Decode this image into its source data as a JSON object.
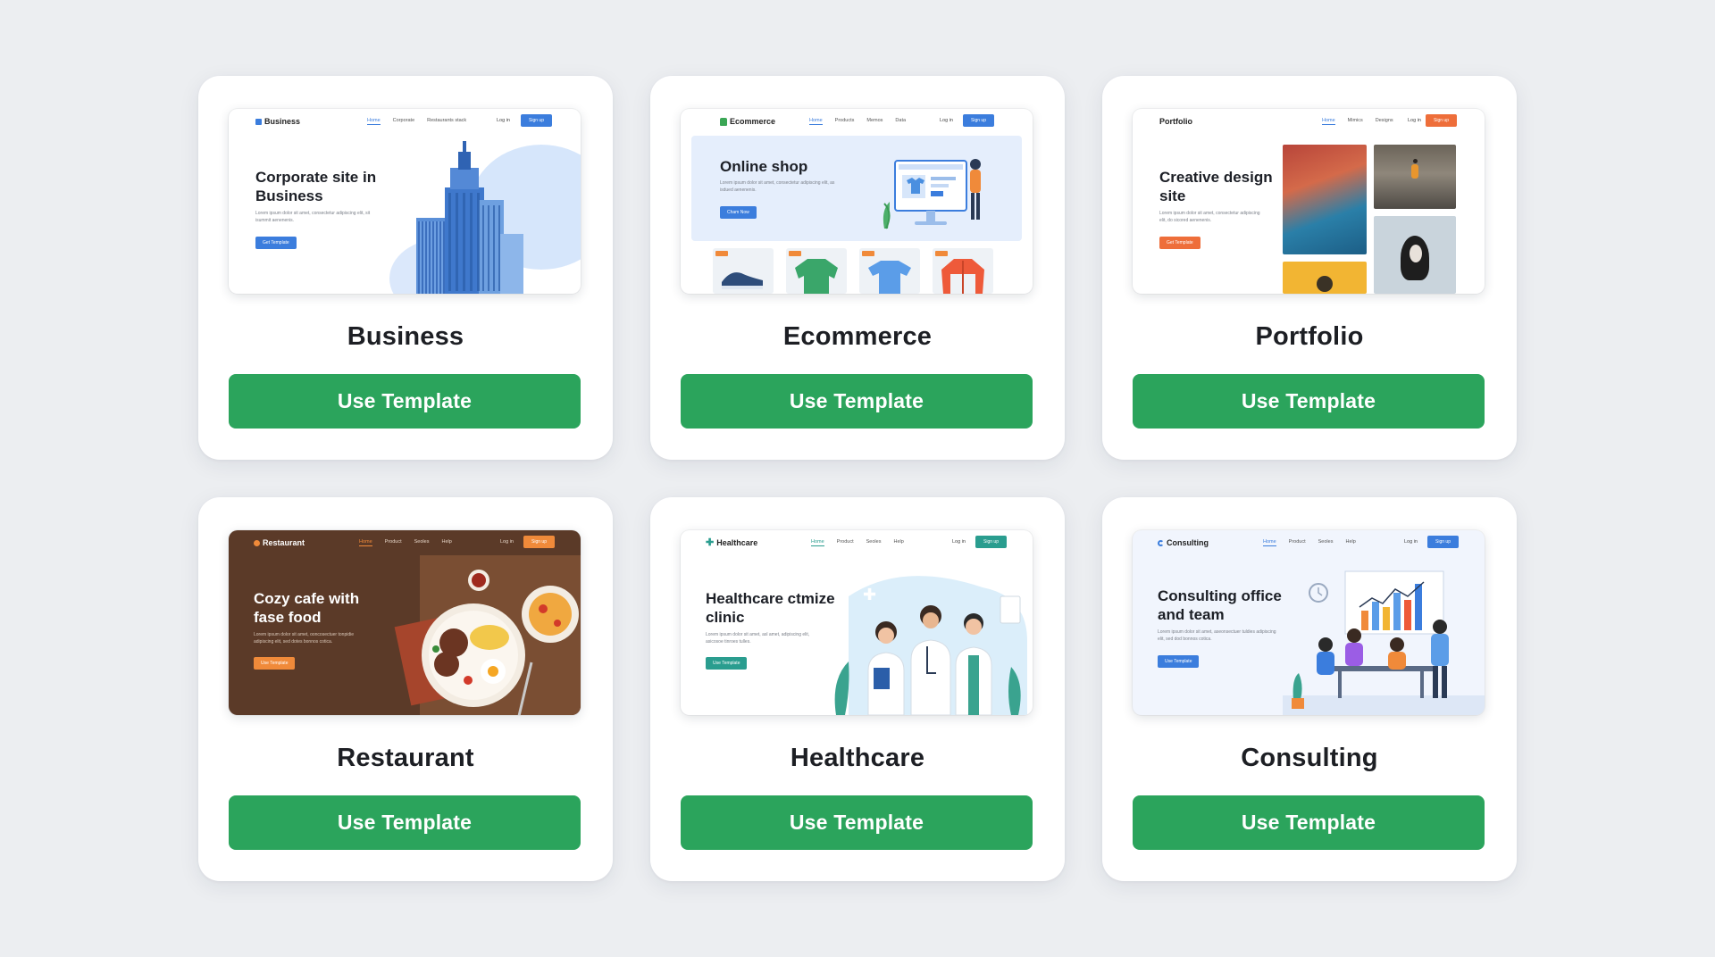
{
  "cards": [
    {
      "title": "Business",
      "button": "Use Template",
      "preview": {
        "brand": "Business",
        "nav": [
          "Home",
          "Corporate",
          "Restaurants stack"
        ],
        "login": "Log in",
        "signup": "Sign up",
        "hero_title": "Corporate site in Business",
        "hero_sub": "Lorem ipsum dolor sit amet, consectetur adipiscing elit, sit isummit aenenenis.",
        "hero_btn": "Get Template",
        "accent": "#3b7ddd",
        "illustration": "office-building-icon"
      }
    },
    {
      "title": "Ecommerce",
      "button": "Use Template",
      "preview": {
        "brand": "Ecommerce",
        "nav": [
          "Home",
          "Products",
          "Memos",
          "Data"
        ],
        "login": "Log in",
        "signup": "Sign up",
        "hero_title": "Online shop",
        "hero_sub": "Lorem ipsum dolor sit amet, consectetur adipiscing elit, as isdued aenenenis.",
        "hero_btn": "Cham Now",
        "accent": "#3b7ddd",
        "illustration": "online-store-icon",
        "products": [
          "sneaker-icon",
          "green-sweater-icon",
          "tshirt-icon",
          "red-jacket-icon"
        ]
      }
    },
    {
      "title": "Portfolio",
      "button": "Use Template",
      "preview": {
        "brand": "Portfolio",
        "nav": [
          "Home",
          "Mimics",
          "Designs"
        ],
        "login": "Log in",
        "signup": "Sign up",
        "hero_title": "Creative design site",
        "hero_sub": "Lorem ipsum dolor sit amet, consectetur adipiscing elit, do sicored aenenenis.",
        "hero_btn": "Get Template",
        "accent": "#ee6e3a",
        "illustration": "photo-gallery-icon"
      }
    },
    {
      "title": "Restaurant",
      "button": "Use Template",
      "preview": {
        "brand": "Restaurant",
        "nav": [
          "Home",
          "Product",
          "Seoles",
          "Help"
        ],
        "login": "Log in",
        "signup": "Sign up",
        "hero_title": "Cozy cafe with fase food",
        "hero_sub": "Lorem ipsum dolor sit amet, ooncosectuer tonpidie adipiscing elit, sed dotes bonnos cotica.",
        "hero_btn": "Use Template",
        "accent": "#f08a3a",
        "illustration": "food-plate-icon"
      }
    },
    {
      "title": "Healthcare",
      "button": "Use Template",
      "preview": {
        "brand": "Healthcare",
        "nav": [
          "Home",
          "Product",
          "Seoles",
          "Help"
        ],
        "login": "Log in",
        "signup": "Sign up",
        "hero_title": "Healthcare ctmize clinic",
        "hero_sub": "Lorem ipsum dolor sit amet, asl amet, adipiscing elit, asicosoe tinroes tulles.",
        "hero_btn": "Use Template",
        "accent": "#2a9d8f",
        "illustration": "doctors-team-icon"
      }
    },
    {
      "title": "Consulting",
      "button": "Use Template",
      "preview": {
        "brand": "Consulting",
        "nav": [
          "Home",
          "Product",
          "Seoles",
          "Help"
        ],
        "login": "Log in",
        "signup": "Sign up",
        "hero_title": "Consulting office and team",
        "hero_sub": "Lorem ipsum dolor sit amet, aseonsectuer tuldies adipiscing elit, sed dod bonnos cotica.",
        "hero_btn": "Use Template",
        "accent": "#3b7ddd",
        "illustration": "meeting-team-icon"
      }
    }
  ]
}
